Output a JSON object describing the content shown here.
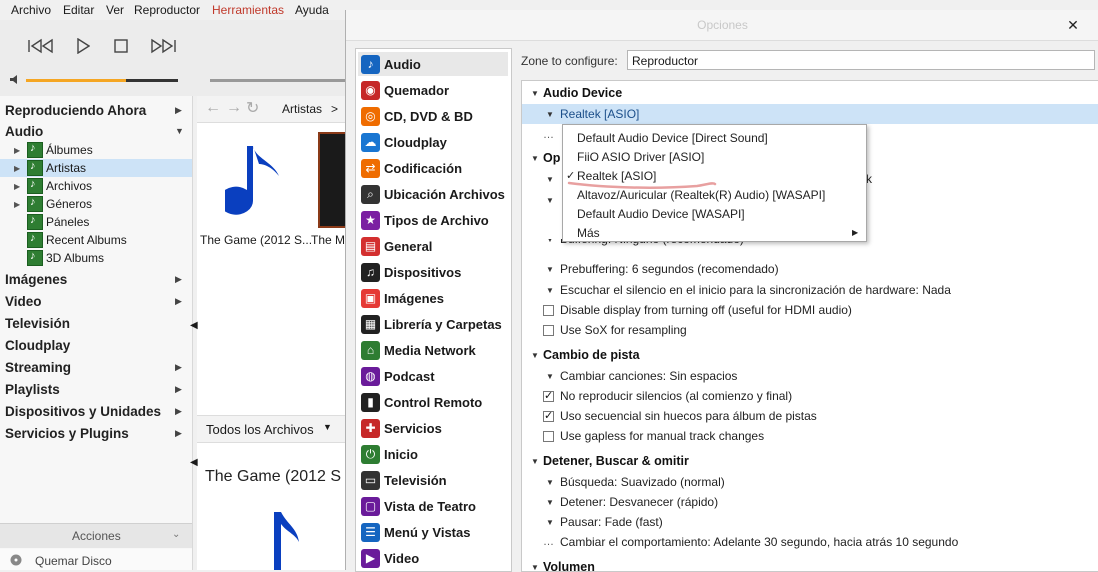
{
  "menubar": {
    "items": [
      "Archivo",
      "Editar",
      "Ver",
      "Reproductor",
      "Herramientas",
      "Ayuda"
    ],
    "active_color": "#c0392b"
  },
  "sidebar": {
    "top_items": [
      "Reproduciendo Ahora",
      "Audio"
    ],
    "audio_children": [
      "Álbumes",
      "Artistas",
      "Archivos",
      "Géneros",
      "Páneles",
      "Recent Albums",
      "3D Albums"
    ],
    "bottom_items": [
      "Imágenes",
      "Video",
      "Televisión",
      "Cloudplay",
      "Streaming",
      "Playlists",
      "Dispositivos y Unidades",
      "Servicios y Plugins"
    ],
    "acciones": "Acciones",
    "quemar": "Quemar Disco"
  },
  "content": {
    "breadcrumb": "Artistas",
    "breadcrumb_sep": ">",
    "tile1": "The Game (2012 S...",
    "tile2": "The M",
    "todos": "Todos los Archivos",
    "big_title": "The Game (2012 S"
  },
  "dialog": {
    "title": "Opciones",
    "close": "✕",
    "zone_label": "Zone to configure:",
    "zone_value": "Reproductor",
    "categories": [
      {
        "label": "Audio",
        "icon": "♪",
        "color": "#1565c0"
      },
      {
        "label": "Quemador",
        "icon": "◉",
        "color": "#c62828"
      },
      {
        "label": "CD, DVD & BD",
        "icon": "◎",
        "color": "#ef6c00"
      },
      {
        "label": "Cloudplay",
        "icon": "☁",
        "color": "#1976d2"
      },
      {
        "label": "Codificación",
        "icon": "⇄",
        "color": "#ef6c00"
      },
      {
        "label": "Ubicación Archivos",
        "icon": "⌕",
        "color": "#333333"
      },
      {
        "label": "Tipos de Archivo",
        "icon": "★",
        "color": "#7b1fa2"
      },
      {
        "label": "General",
        "icon": "▤",
        "color": "#d32f2f"
      },
      {
        "label": "Dispositivos",
        "icon": "♫",
        "color": "#222222"
      },
      {
        "label": "Imágenes",
        "icon": "▣",
        "color": "#e53935"
      },
      {
        "label": "Librería y Carpetas",
        "icon": "▦",
        "color": "#222222"
      },
      {
        "label": "Media Network",
        "icon": "⌂",
        "color": "#2e7d32"
      },
      {
        "label": "Podcast",
        "icon": "◍",
        "color": "#6a1b9a"
      },
      {
        "label": "Control Remoto",
        "icon": "▮",
        "color": "#222222"
      },
      {
        "label": "Servicios",
        "icon": "✚",
        "color": "#c62828"
      },
      {
        "label": "Inicio",
        "icon": "⏻",
        "color": "#2e7d32"
      },
      {
        "label": "Televisión",
        "icon": "▭",
        "color": "#333333"
      },
      {
        "label": "Vista de Teatro",
        "icon": "▢",
        "color": "#6a1b9a"
      },
      {
        "label": "Menú y Vistas",
        "icon": "☰",
        "color": "#1565c0"
      },
      {
        "label": "Video",
        "icon": "▶",
        "color": "#6a1b9a"
      }
    ],
    "settings": {
      "audio_device_header": "Audio Device",
      "audio_device_value": "Realtek [ASIO]",
      "op_header": "Op",
      "op_suffix": "ck",
      "buffering": "Buffering: Ninguno (recomendado)",
      "prebuffering": "Prebuffering: 6 segundos (recomendado)",
      "silence": "Escuchar el silencio en el inicio para la sincronización de hardware: Nada",
      "disable_display": "Disable display from turning off (useful for HDMI audio)",
      "sox": "Use SoX for resampling",
      "track_header": "Cambio de pista",
      "change_tracks": "Cambiar canciones: Sin espacios",
      "no_silence": "No reproducir silencios (al comienzo y final)",
      "gapless_seq": "Uso secuencial sin huecos para álbum de pistas",
      "gapless_manual": "Use gapless for manual track changes",
      "stop_header": "Detener, Buscar & omitir",
      "search": "Búsqueda: Suavizado (normal)",
      "stop": "Detener: Desvanecer (rápido)",
      "pause": "Pausar: Fade (fast)",
      "behavior": "Cambiar el comportamiento: Adelante 30 segundo, hacia atrás 10 segundo",
      "volume_header": "Volumen"
    },
    "popup": {
      "items": [
        "Default Audio Device [Direct Sound]",
        "FiiO ASIO Driver [ASIO]",
        "Realtek [ASIO]",
        "Altavoz/Auricular (Realtek(R) Audio) [WASAPI]",
        "Default Audio Device [WASAPI]",
        "Más"
      ],
      "checked_index": 2
    }
  },
  "colors": {
    "selection": "#cde3f7",
    "accent_orange": "#f5a623",
    "note_blue": "#0a3fbf",
    "annotation_red": "#e8a0a0"
  }
}
